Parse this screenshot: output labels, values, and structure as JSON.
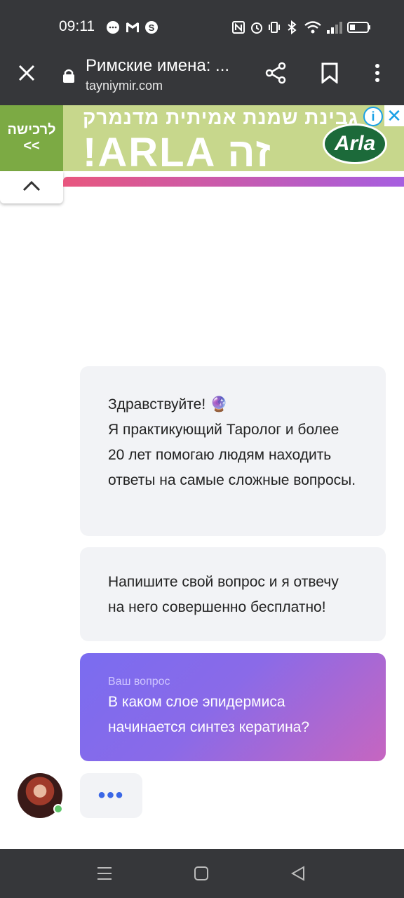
{
  "status_bar": {
    "time": "09:11",
    "icons": [
      "chat-bubble-icon",
      "gmail-icon",
      "skype-icon",
      "nfc-icon",
      "alarm-icon",
      "vibrate-icon",
      "bluetooth-icon",
      "wifi-icon",
      "signal-icon",
      "battery-icon"
    ]
  },
  "browser": {
    "page_title": "Римские имена: ...",
    "url": "tayniymir.com",
    "icons": [
      "close-icon",
      "lock-icon",
      "share-icon",
      "bookmark-icon",
      "more-icon"
    ]
  },
  "ad": {
    "left_label": "לרכישה",
    "left_arrows": "<<",
    "top_text": "גבינת שמנת אמיתית מדנמרק",
    "main_text": "!ARLA זה",
    "brand": "Arla",
    "info_icon": "i",
    "close_icon": "✕",
    "colors": {
      "background": "#c7d78c",
      "left": "#7caa44",
      "logo": "#1c6a3a"
    }
  },
  "chat": {
    "greeting": {
      "line1": "Здравствуйте! 🔮",
      "body": "Я практикующий Таролог и более 20 лет помогаю людям находить ответы на самые сложные вопросы."
    },
    "invite": "Напишите свой вопрос и я отвечу на него совершенно бесплатно!",
    "user_message": {
      "label": "Ваш вопрос",
      "text": "В каком слое эпидермиса начинается синтез кератина?"
    },
    "typing_indicator": "•••",
    "colors": {
      "bubble": "#f2f3f6",
      "user_gradient_start": "#7a6cf0",
      "user_gradient_end": "#c666c0",
      "online": "#5ec66a"
    }
  },
  "nav_bar": {
    "icons": [
      "menu-icon",
      "home-icon",
      "back-icon"
    ]
  }
}
